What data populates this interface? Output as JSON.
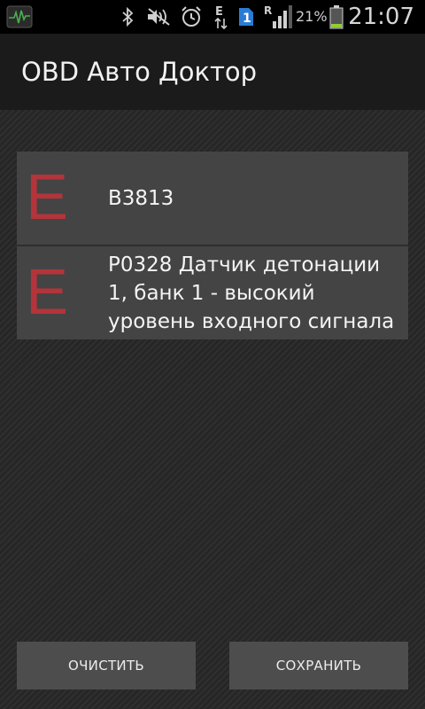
{
  "status_bar": {
    "icons": [
      "app-icon",
      "bluetooth-icon",
      "no-signal-icon",
      "alarm-icon",
      "edge-icon",
      "sim-icon",
      "signal-icon",
      "battery-icon"
    ],
    "edge_label": "E",
    "sim_label": "1",
    "roaming_label": "R",
    "battery_percent": "21%",
    "battery_level": 0.21,
    "time": "21:07"
  },
  "action_bar": {
    "title": "OBD Авто Доктор"
  },
  "errors": [
    {
      "code_letter": "E",
      "text": "B3813"
    },
    {
      "code_letter": "E",
      "text": "P0328 Датчик детонации 1, банк 1 - высокий уровень входного сигнала"
    }
  ],
  "buttons": {
    "clear_label": "ОЧИСТИТЬ",
    "save_label": "СОХРАНИТЬ"
  },
  "colors": {
    "error_letter": "#b3343a",
    "battery_fill": "#8fcf2f",
    "sim_badge": "#2a7bd6"
  }
}
